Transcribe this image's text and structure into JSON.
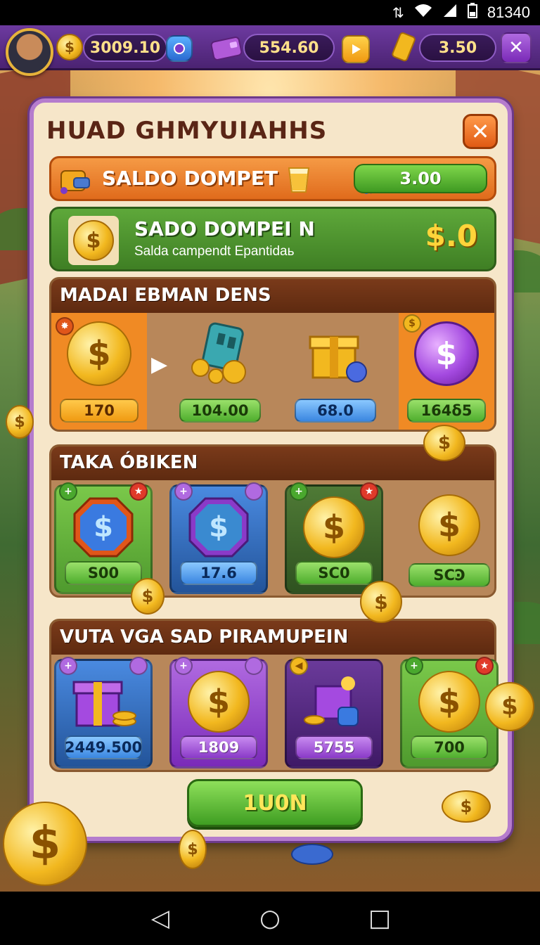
{
  "status_bar": {
    "time": "81340",
    "icons": [
      "data-icon",
      "wifi-icon",
      "signal-icon",
      "battery-icon"
    ]
  },
  "topbar": {
    "coins": "3009.10",
    "gems_or_cards": "554.60",
    "gold_bars": "3.50",
    "icons": [
      "avatar",
      "coin-icon",
      "blue-gem-icon",
      "purple-wallet-icon",
      "play-button-icon",
      "gold-bar-icon",
      "close-icon"
    ]
  },
  "panel": {
    "title": "HUAD GHMYUIAHHS",
    "close_icon": "close-icon",
    "saldo": {
      "label": "SALDO DOMPET",
      "value": "3.00",
      "icons": [
        "wallet-icon",
        "cup-icon",
        "purple-wallet-icon"
      ]
    },
    "banner": {
      "title": "SADO DOMPEI N",
      "subtitle": "Salda campendt Epantidaь",
      "amount": "$.0"
    },
    "section1": {
      "title": "MADAI EBMAN DENS",
      "items": [
        {
          "price": "170",
          "icon": "gold-coin-icon",
          "color": "#f08a24"
        },
        {
          "price": "104.00",
          "icon": "teal-wallet-coins-icon",
          "color": "#9a6a3a"
        },
        {
          "price": "68.0",
          "icon": "gold-gift-box-icon",
          "color": "#9a6a3a"
        },
        {
          "price": "164δ5",
          "icon": "purple-coin-icon",
          "color": "#f08a24"
        }
      ]
    },
    "section2": {
      "title": "TAKA ÓBIKEN",
      "items": [
        {
          "price": "S00",
          "icon": "blue-badge-coin-icon",
          "color": "#5aa83a"
        },
        {
          "price": "17.6",
          "icon": "purple-badge-coin-icon",
          "color": "#2f6ac0"
        },
        {
          "price": "SC0",
          "icon": "gold-coin-icon",
          "color": "#3f6a2a"
        },
        {
          "price": "SCϿ",
          "icon": "gold-coin-icon",
          "color": "#9a6a3a"
        }
      ]
    },
    "section3": {
      "title": "VUTA VGA SAD PIRAMUPEIN",
      "items": [
        {
          "price": "2449.500",
          "icon": "purple-gift-box-icon",
          "color": "#2f6ac0"
        },
        {
          "price": "1809",
          "icon": "gold-coin-icon",
          "color": "#8a3ac8"
        },
        {
          "price": "5755",
          "icon": "purple-box-icon",
          "color": "#5a2a8a"
        },
        {
          "price": "700",
          "icon": "gold-coin-icon",
          "color": "#5aa83a"
        }
      ]
    },
    "confirm_label": "1U0N"
  },
  "nav_bar": {
    "back": "◁",
    "home": "○",
    "recents": "□"
  }
}
